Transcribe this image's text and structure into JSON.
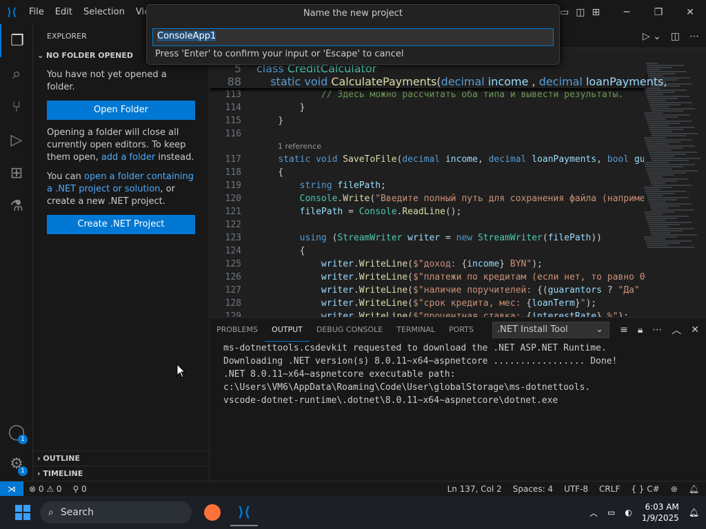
{
  "titlebar": {
    "menus": [
      "File",
      "Edit",
      "Selection",
      "View"
    ]
  },
  "quick_input": {
    "title": "Name the new project",
    "value": "ConsoleApp1",
    "message": "Press 'Enter' to confirm your input or 'Escape' to cancel"
  },
  "sidebar": {
    "title": "EXPLORER",
    "section": "NO FOLDER OPENED",
    "text1": "You have not yet opened a folder.",
    "open_folder_btn": "Open Folder",
    "text2_a": "Opening a folder will close all currently open editors. To keep them open, ",
    "text2_link": "add a folder",
    "text2_b": " instead.",
    "text3_a": "You can ",
    "text3_link": "open a folder containing a .NET project or solution",
    "text3_b": ", or create a new .NET project.",
    "create_btn": "Create .NET Project",
    "outline": "OUTLINE",
    "timeline": "TIMELINE",
    "account_badge": "1",
    "settings_badge": "1"
  },
  "editor": {
    "sticky": [
      {
        "ln": "5",
        "parts": [
          [
            "kw",
            "class "
          ],
          [
            "ty",
            "CreditCalculator"
          ]
        ]
      },
      {
        "ln": "88",
        "parts": [
          [
            "",
            "    "
          ],
          [
            "kw",
            "static void "
          ],
          [
            "fn",
            "CalculatePayments"
          ],
          [
            "",
            "("
          ],
          [
            "kw",
            "decimal "
          ],
          [
            "va",
            "income"
          ],
          [
            "",
            " , "
          ],
          [
            "kw",
            "decimal "
          ],
          [
            "va",
            "loanPayments"
          ],
          [
            "",
            ", "
          ]
        ]
      }
    ],
    "lines": [
      {
        "ln": "113",
        "parts": [
          [
            "",
            "            "
          ],
          [
            "cm",
            "// Здесь можно рассчитать оба типа и вывести результаты."
          ]
        ]
      },
      {
        "ln": "114",
        "parts": [
          [
            "",
            "        }"
          ]
        ]
      },
      {
        "ln": "115",
        "parts": [
          [
            "",
            "    }"
          ]
        ]
      },
      {
        "ln": "116",
        "parts": [
          [
            "",
            ""
          ]
        ]
      },
      {
        "lens": "1 reference"
      },
      {
        "ln": "117",
        "parts": [
          [
            "",
            "    "
          ],
          [
            "kw",
            "static void "
          ],
          [
            "fn",
            "SaveToFile"
          ],
          [
            "",
            "("
          ],
          [
            "kw",
            "decimal "
          ],
          [
            "va",
            "income"
          ],
          [
            "",
            ", "
          ],
          [
            "kw",
            "decimal "
          ],
          [
            "va",
            "loanPayments"
          ],
          [
            "",
            ", "
          ],
          [
            "kw",
            "bool "
          ],
          [
            "va",
            "gua"
          ]
        ]
      },
      {
        "ln": "118",
        "parts": [
          [
            "",
            "    {"
          ]
        ]
      },
      {
        "ln": "119",
        "parts": [
          [
            "",
            "        "
          ],
          [
            "kw",
            "string "
          ],
          [
            "va",
            "filePath"
          ],
          [
            "",
            ";"
          ]
        ]
      },
      {
        "ln": "120",
        "parts": [
          [
            "",
            "        "
          ],
          [
            "ty",
            "Console"
          ],
          [
            "",
            "."
          ],
          [
            "fn",
            "Write"
          ],
          [
            "",
            "("
          ],
          [
            "st",
            "\"Введите полный путь для сохранения файла (например"
          ]
        ]
      },
      {
        "ln": "121",
        "parts": [
          [
            "",
            "        "
          ],
          [
            "va",
            "filePath"
          ],
          [
            "",
            " = "
          ],
          [
            "ty",
            "Console"
          ],
          [
            "",
            "."
          ],
          [
            "fn",
            "ReadLine"
          ],
          [
            "",
            "();"
          ]
        ]
      },
      {
        "ln": "122",
        "parts": [
          [
            "",
            ""
          ]
        ]
      },
      {
        "ln": "123",
        "parts": [
          [
            "",
            "        "
          ],
          [
            "kw",
            "using "
          ],
          [
            "",
            "("
          ],
          [
            "ty",
            "StreamWriter "
          ],
          [
            "va",
            "writer"
          ],
          [
            "",
            " = "
          ],
          [
            "kw",
            "new "
          ],
          [
            "ty",
            "StreamWriter"
          ],
          [
            "",
            "("
          ],
          [
            "va",
            "filePath"
          ],
          [
            "",
            "))"
          ]
        ]
      },
      {
        "ln": "124",
        "parts": [
          [
            "",
            "        {"
          ]
        ]
      },
      {
        "ln": "125",
        "parts": [
          [
            "",
            "            "
          ],
          [
            "va",
            "writer"
          ],
          [
            "",
            "."
          ],
          [
            "fn",
            "WriteLine"
          ],
          [
            "",
            "("
          ],
          [
            "st",
            "$\"доход: "
          ],
          [
            "",
            "{"
          ],
          [
            "va",
            "income"
          ],
          [
            "",
            "}"
          ],
          [
            "st",
            " BYN\""
          ],
          [
            "",
            ");"
          ]
        ]
      },
      {
        "ln": "126",
        "parts": [
          [
            "",
            "            "
          ],
          [
            "va",
            "writer"
          ],
          [
            "",
            "."
          ],
          [
            "fn",
            "WriteLine"
          ],
          [
            "",
            "("
          ],
          [
            "st",
            "$\"платежи по кредитам (если нет, то равно 0"
          ]
        ]
      },
      {
        "ln": "127",
        "parts": [
          [
            "",
            "            "
          ],
          [
            "va",
            "writer"
          ],
          [
            "",
            "."
          ],
          [
            "fn",
            "WriteLine"
          ],
          [
            "",
            "("
          ],
          [
            "st",
            "$\"наличие поручителей: "
          ],
          [
            "",
            "{("
          ],
          [
            "va",
            "guarantors"
          ],
          [
            "",
            " ? "
          ],
          [
            "st",
            "\"Да\""
          ]
        ]
      },
      {
        "ln": "128",
        "parts": [
          [
            "",
            "            "
          ],
          [
            "va",
            "writer"
          ],
          [
            "",
            "."
          ],
          [
            "fn",
            "WriteLine"
          ],
          [
            "",
            "("
          ],
          [
            "st",
            "$\"срок кредита, мес: "
          ],
          [
            "",
            "{"
          ],
          [
            "va",
            "loanTerm"
          ],
          [
            "",
            "}"
          ],
          [
            "st",
            "\""
          ],
          [
            "",
            ");"
          ]
        ]
      },
      {
        "ln": "129",
        "parts": [
          [
            "",
            "            "
          ],
          [
            "va",
            "writer"
          ],
          [
            "",
            "."
          ],
          [
            "fn",
            "WriteLine"
          ],
          [
            "",
            "("
          ],
          [
            "st",
            "$\"процентная ставка: "
          ],
          [
            "",
            "{"
          ],
          [
            "va",
            "interestRate"
          ],
          [
            "",
            "}"
          ],
          [
            "st",
            " %\""
          ],
          [
            "",
            ");"
          ]
        ]
      }
    ]
  },
  "panel": {
    "tabs": [
      "PROBLEMS",
      "OUTPUT",
      "DEBUG CONSOLE",
      "TERMINAL",
      "PORTS"
    ],
    "active_tab": "OUTPUT",
    "channel": ".NET Install Tool",
    "output": "ms-dotnettools.csdevkit requested to download the .NET ASP.NET Runtime.\nDownloading .NET version(s) 8.0.11~x64~aspnetcore ................. Done!\n.NET 8.0.11~x64~aspnetcore executable path:\nc:\\Users\\VM6\\AppData\\Roaming\\Code\\User\\globalStorage\\ms-dotnettools.\nvscode-dotnet-runtime\\.dotnet\\8.0.11~x64~aspnetcore\\dotnet.exe"
  },
  "statusbar": {
    "errors": "0",
    "warnings": "0",
    "ports": "0",
    "position": "Ln 137, Col 2",
    "spaces": "Spaces: 4",
    "encoding": "UTF-8",
    "eol": "CRLF",
    "language": "C#"
  },
  "taskbar": {
    "search": "Search",
    "time": "6:03 AM",
    "date": "1/9/2025"
  }
}
